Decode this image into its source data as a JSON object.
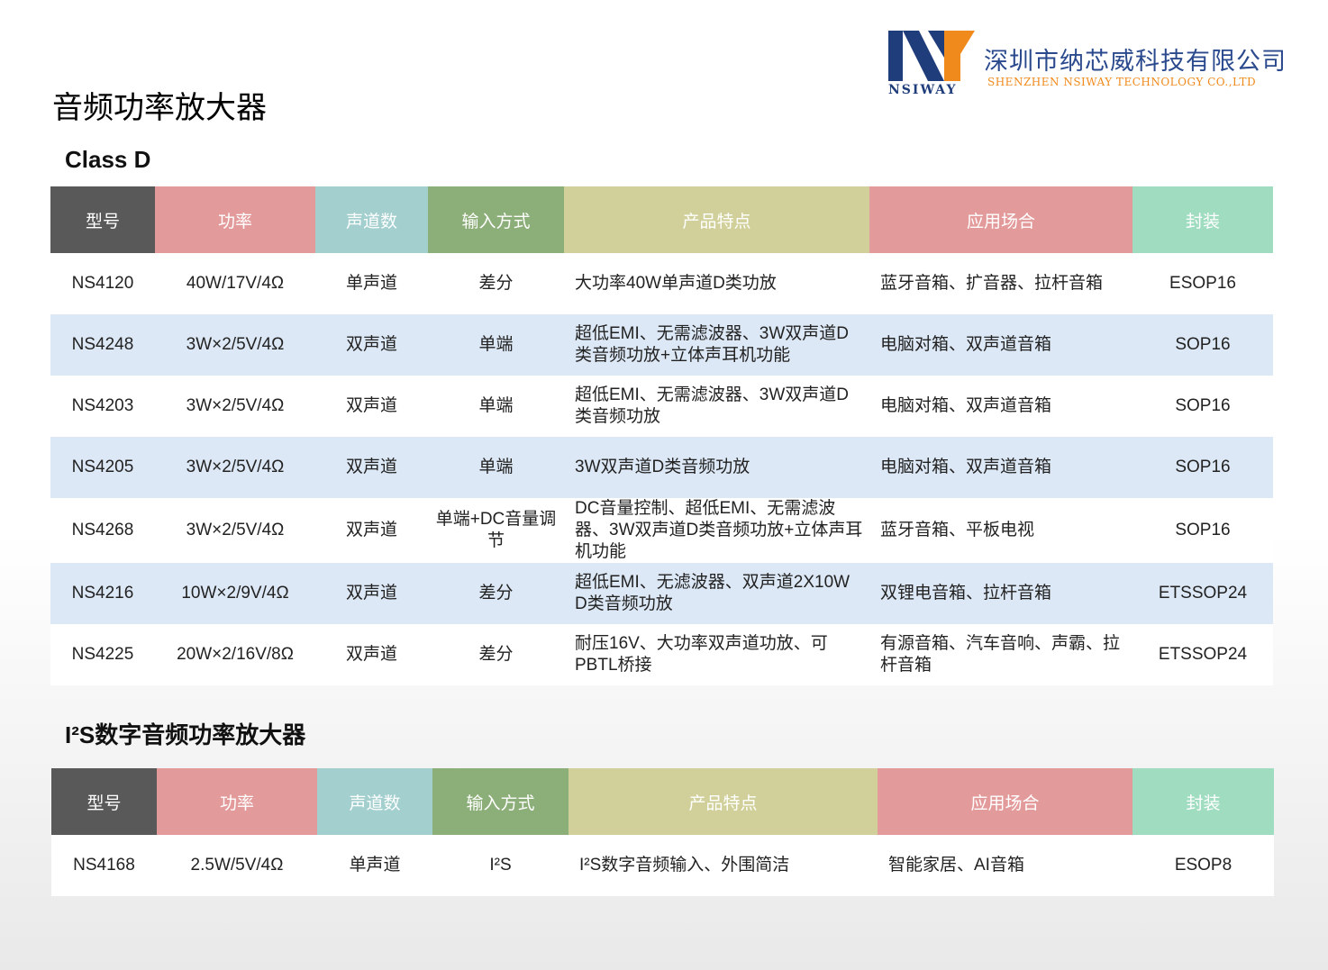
{
  "page": {
    "title": "音频功率放大器"
  },
  "logo": {
    "company_cn": "深圳市纳芯威科技有限公司",
    "company_en": "SHENZHEN NSIWAY TECHNOLOGY CO.,LTD",
    "brand": "NSIWAY"
  },
  "colors": {
    "col_model": "#595959",
    "col_power": "#e39a9a",
    "col_channels": "#a3cfcf",
    "col_input": "#8cae78",
    "col_features": "#d1d09a",
    "col_applications": "#e39a9a",
    "col_package": "#9fdcc0",
    "row_alt": "#dde8f6"
  },
  "section_class_d": {
    "title": "Class D",
    "headers": [
      "型号",
      "功率",
      "声道数",
      "输入方式",
      "产品特点",
      "应用场合",
      "封装"
    ],
    "rows": [
      [
        "NS4120",
        "40W/17V/4Ω",
        "单声道",
        "差分",
        "大功率40W单声道D类功放",
        "蓝牙音箱、扩音器、拉杆音箱",
        "ESOP16"
      ],
      [
        "NS4248",
        "3W×2/5V/4Ω",
        "双声道",
        "单端",
        "超低EMI、无需滤波器、3W双声道D类音频功放+立体声耳机功能",
        "电脑对箱、双声道音箱",
        "SOP16"
      ],
      [
        "NS4203",
        "3W×2/5V/4Ω",
        "双声道",
        "单端",
        "超低EMI、无需滤波器、3W双声道D类音频功放",
        "电脑对箱、双声道音箱",
        "SOP16"
      ],
      [
        "NS4205",
        "3W×2/5V/4Ω",
        "双声道",
        "单端",
        "3W双声道D类音频功放",
        "电脑对箱、双声道音箱",
        "SOP16"
      ],
      [
        "NS4268",
        "3W×2/5V/4Ω",
        "双声道",
        "单端+DC音量调节",
        "DC音量控制、超低EMI、无需滤波器、3W双声道D类音频功放+立体声耳机功能",
        "蓝牙音箱、平板电视",
        "SOP16"
      ],
      [
        "NS4216",
        "10W×2/9V/4Ω",
        "双声道",
        "差分",
        "超低EMI、无滤波器、双声道2X10W D类音频功放",
        "双锂电音箱、拉杆音箱",
        "ETSSOP24"
      ],
      [
        "NS4225",
        "20W×2/16V/8Ω",
        "双声道",
        "差分",
        "耐压16V、大功率双声道功放、可PBTL桥接",
        "有源音箱、汽车音响、声霸、拉杆音箱",
        "ETSSOP24"
      ]
    ]
  },
  "section_i2s": {
    "title": "I²S数字音频功率放大器",
    "headers": [
      "型号",
      "功率",
      "声道数",
      "输入方式",
      "产品特点",
      "应用场合",
      "封装"
    ],
    "rows": [
      [
        "NS4168",
        "2.5W/5V/4Ω",
        "单声道",
        "I²S",
        "I²S数字音频输入、外围简洁",
        "智能家居、AI音箱",
        "ESOP8"
      ]
    ]
  }
}
